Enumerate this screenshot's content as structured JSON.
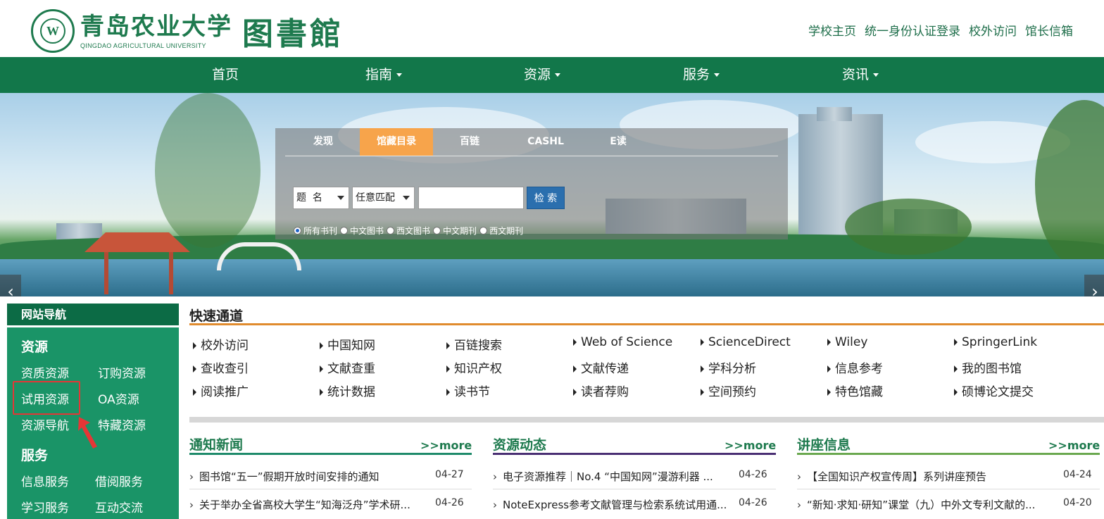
{
  "header": {
    "logo_cn": "青岛农业大学",
    "logo_en": "QINGDAO AGRICULTURAL UNIVERSITY",
    "library_name": "图書館",
    "top_links": [
      "学校主页",
      "统一身份认证登录",
      "校外访问",
      "馆长信箱"
    ]
  },
  "nav": {
    "items": [
      {
        "label": "首页"
      },
      {
        "label": "指南"
      },
      {
        "label": "资源"
      },
      {
        "label": "服务"
      },
      {
        "label": "资讯"
      }
    ]
  },
  "search": {
    "tabs": [
      "发现",
      "馆藏目录",
      "百链",
      "CASHL",
      "E读"
    ],
    "active_tab": "馆藏目录",
    "field_select": "题  名",
    "match_select": "任意匹配",
    "input_value": "",
    "button_label": "检 索",
    "radios": [
      "所有书刊",
      "中文图书",
      "西文图书",
      "中文期刊",
      "西文期刊"
    ],
    "selected_radio": "所有书刊"
  },
  "sidebar": {
    "title": "网站导航",
    "sections": [
      {
        "name": "资源",
        "links": [
          "资质资源",
          "订购资源",
          "试用资源",
          "OA资源",
          "资源导航",
          "特藏资源"
        ]
      },
      {
        "name": "服务",
        "links": [
          "信息服务",
          "借阅服务",
          "学习服务",
          "互动交流"
        ]
      }
    ],
    "highlighted": "试用资源"
  },
  "quick_channel": {
    "title": "快速通道",
    "rows": [
      [
        "校外访问",
        "中国知网",
        "百链搜索",
        "Web of Science",
        "ScienceDirect",
        "Wiley",
        "SpringerLink"
      ],
      [
        "查收查引",
        "文献查重",
        "知识产权",
        "文献传递",
        "学科分析",
        "信息参考",
        "我的图书馆"
      ],
      [
        "阅读推广",
        "统计数据",
        "读书节",
        "读者荐购",
        "空间预约",
        "特色馆藏",
        "硕博论文提交"
      ]
    ]
  },
  "columns": [
    {
      "title": "通知新闻",
      "more": ">>more",
      "color": "#1e8a6a",
      "items": [
        {
          "text": "图书馆“五一”假期开放时间安排的通知",
          "date": "04-27"
        },
        {
          "text": "关于举办全省高校大学生“知海泛舟”学术研...",
          "date": "04-26"
        }
      ]
    },
    {
      "title": "资源动态",
      "more": ">>more",
      "color": "#4a2f73",
      "items": [
        {
          "text": "电子资源推荐｜No.4 “中国知网”漫游利器 ...",
          "date": "04-26"
        },
        {
          "text": "NoteExpress参考文献管理与检索系统试用通...",
          "date": "04-26"
        }
      ]
    },
    {
      "title": "讲座信息",
      "more": ">>more",
      "color": "#6aa84f",
      "items": [
        {
          "text": "【全国知识产权宣传周】系列讲座预告",
          "date": "04-24"
        },
        {
          "text": "“新知·求知·研知”课堂（九）中外文专利文献的...",
          "date": "04-20"
        }
      ]
    }
  ],
  "colors": {
    "brand": "#12774a",
    "accent": "#f7a44b",
    "highlight": "#e53636"
  }
}
